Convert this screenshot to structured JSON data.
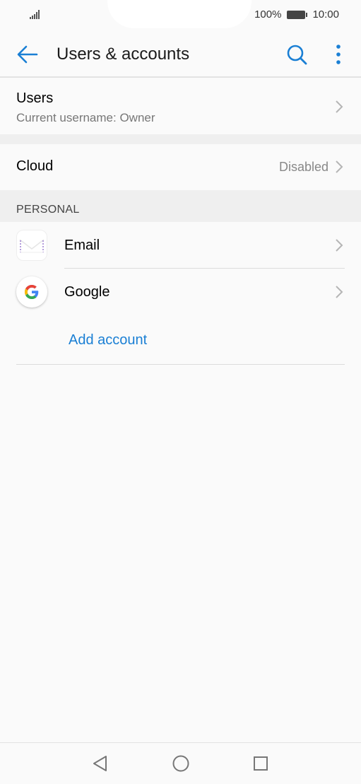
{
  "status_bar": {
    "battery": "100%",
    "time": "10:00"
  },
  "toolbar": {
    "title": "Users & accounts"
  },
  "users": {
    "title": "Users",
    "subtitle": "Current username: Owner"
  },
  "cloud": {
    "title": "Cloud",
    "value": "Disabled"
  },
  "personal": {
    "header": "PERSONAL",
    "accounts": [
      {
        "label": "Email",
        "icon": "email-app-icon"
      },
      {
        "label": "Google",
        "icon": "google-icon"
      }
    ],
    "add_account": "Add account"
  },
  "nav": {
    "icons": [
      "back-triangle-icon",
      "home-circle-icon",
      "recents-square-icon"
    ]
  },
  "colors": {
    "accent": "#1a7fd4",
    "background": "#fafafa",
    "section": "#efefef"
  }
}
